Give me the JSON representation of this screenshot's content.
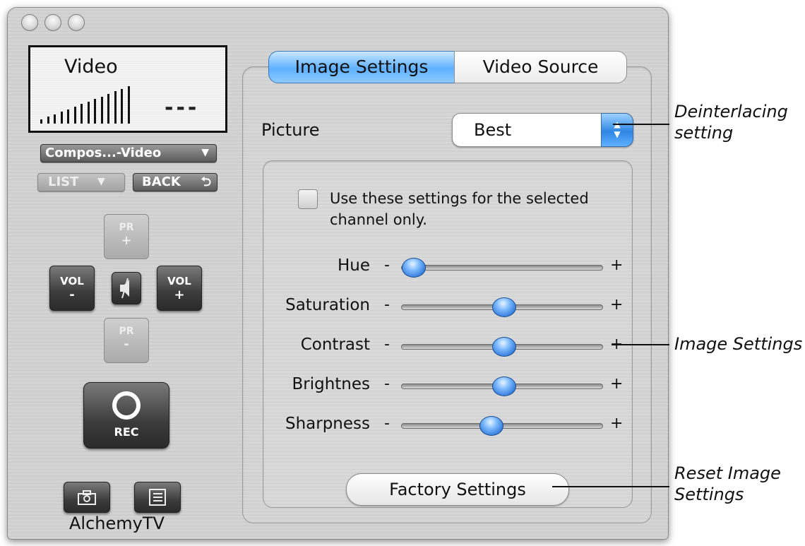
{
  "window": {
    "app_name": "AlchemyTV"
  },
  "display": {
    "title": "Video",
    "channel": "---",
    "signal_bars": 14
  },
  "source_select": {
    "value": "Compos...-Video"
  },
  "list_button": {
    "label": "LIST"
  },
  "back_button": {
    "label": "BACK"
  },
  "remote": {
    "pr_plus": [
      "PR",
      "+"
    ],
    "pr_minus": [
      "PR",
      "-"
    ],
    "vol_minus": [
      "VOL",
      "-"
    ],
    "vol_plus": [
      "VOL",
      "+"
    ],
    "rec": "REC"
  },
  "tabs": [
    {
      "label": "Image Settings",
      "selected": true
    },
    {
      "label": "Video Source",
      "selected": false
    }
  ],
  "picture": {
    "label": "Picture",
    "value": "Best"
  },
  "channel_only": {
    "label_line1": "Use these settings for the selected",
    "label_line2": "channel only.",
    "checked": false
  },
  "sliders": [
    {
      "label": "Hue",
      "value": 0.02
    },
    {
      "label": "Saturation",
      "value": 0.52
    },
    {
      "label": "Contrast",
      "value": 0.52
    },
    {
      "label": "Brightnes",
      "value": 0.52
    },
    {
      "label": "Sharpness",
      "value": 0.45
    }
  ],
  "slider_minus": "-",
  "slider_plus": "+",
  "factory_button": {
    "label": "Factory Settings"
  },
  "callouts": {
    "deinterlacing": [
      "Deinterlacing",
      "setting"
    ],
    "image_settings": "Image Settings",
    "reset": [
      "Reset Image",
      "Settings"
    ]
  },
  "colors": {
    "accent": "#4a9cf0",
    "knob": "#2c74d6"
  }
}
